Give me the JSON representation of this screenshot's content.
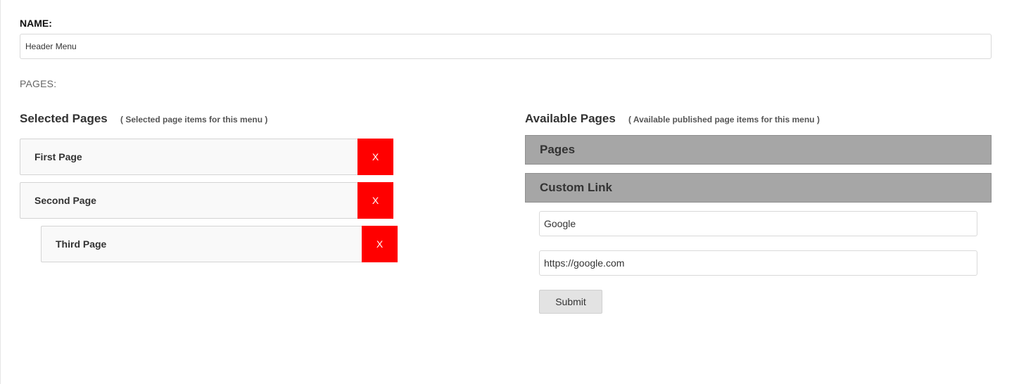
{
  "form": {
    "name_label": "NAME:",
    "name_value": "Header Menu",
    "pages_label": "PAGES:"
  },
  "selected": {
    "title": "Selected Pages",
    "hint": "( Selected page items for this menu )",
    "items": [
      {
        "label": "First Page",
        "remove_label": "X"
      },
      {
        "label": "Second Page",
        "remove_label": "X"
      },
      {
        "label": "Third Page",
        "remove_label": "X"
      }
    ]
  },
  "available": {
    "title": "Available Pages",
    "hint": "( Available published page items for this menu )",
    "sections": [
      {
        "label": "Pages"
      },
      {
        "label": "Custom Link"
      }
    ],
    "custom_link": {
      "title_value": "Google",
      "url_value": "https://google.com",
      "submit_label": "Submit"
    }
  },
  "colors": {
    "remove_button": "#ff0000",
    "accordion_header": "#a6a6a6",
    "submit_button": "#e3e3e3"
  }
}
